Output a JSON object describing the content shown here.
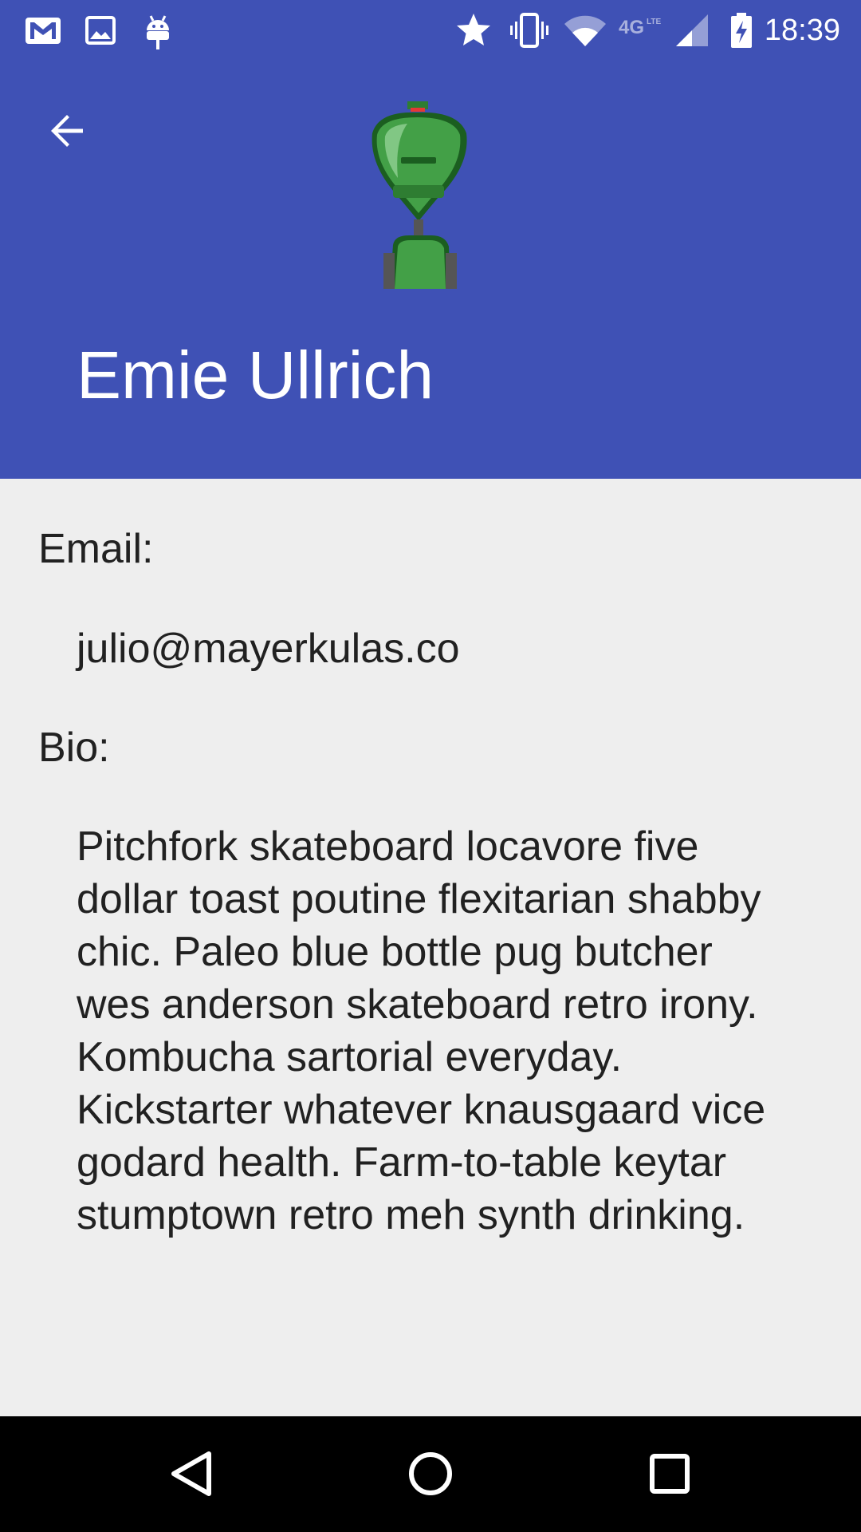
{
  "status_bar": {
    "time": "18:39",
    "notification_icons": [
      "gmail-icon",
      "gallery-icon",
      "android-debug-icon"
    ],
    "system_icons": [
      "star-icon",
      "vibrate-icon",
      "wifi-icon",
      "4g-lte-icon",
      "signal-icon",
      "battery-charging-icon"
    ]
  },
  "header": {
    "name": "Emie Ullrich",
    "back_icon": "arrow-back-icon",
    "avatar_icon": "robot-avatar-icon",
    "background_color": "#3f51b5"
  },
  "profile": {
    "email_label": "Email:",
    "email": "julio@mayerkulas.co",
    "bio_label": "Bio:",
    "bio": "Pitchfork skateboard locavore five dollar toast poutine flexitarian shabby chic. Paleo blue bottle pug butcher wes anderson skateboard retro irony. Kombucha sartorial everyday. Kickstarter whatever knausgaard vice godard health. Farm-to-table keytar stumptown retro meh synth drinking."
  },
  "nav_bar": {
    "buttons": [
      "back-icon",
      "home-icon",
      "recents-icon"
    ]
  }
}
